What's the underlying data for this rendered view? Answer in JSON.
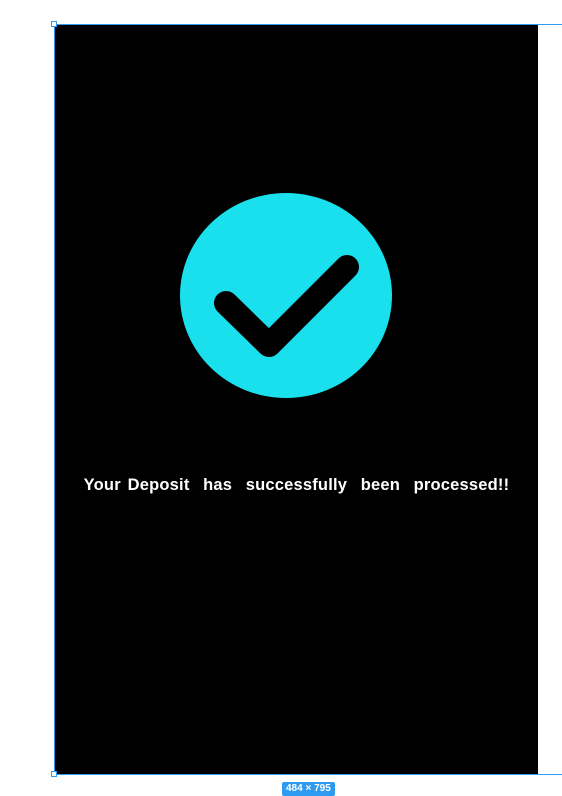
{
  "message": {
    "text": "Your Deposit  has  successfully  been  processed!!"
  },
  "icon": {
    "name": "check-circle-icon",
    "circle_color": "#19e0ec",
    "check_color": "#000000"
  },
  "frame": {
    "background": "#000000",
    "size_label": "484 × 795"
  },
  "colors": {
    "selection": "#2f9bf0",
    "text": "#ffffff"
  }
}
